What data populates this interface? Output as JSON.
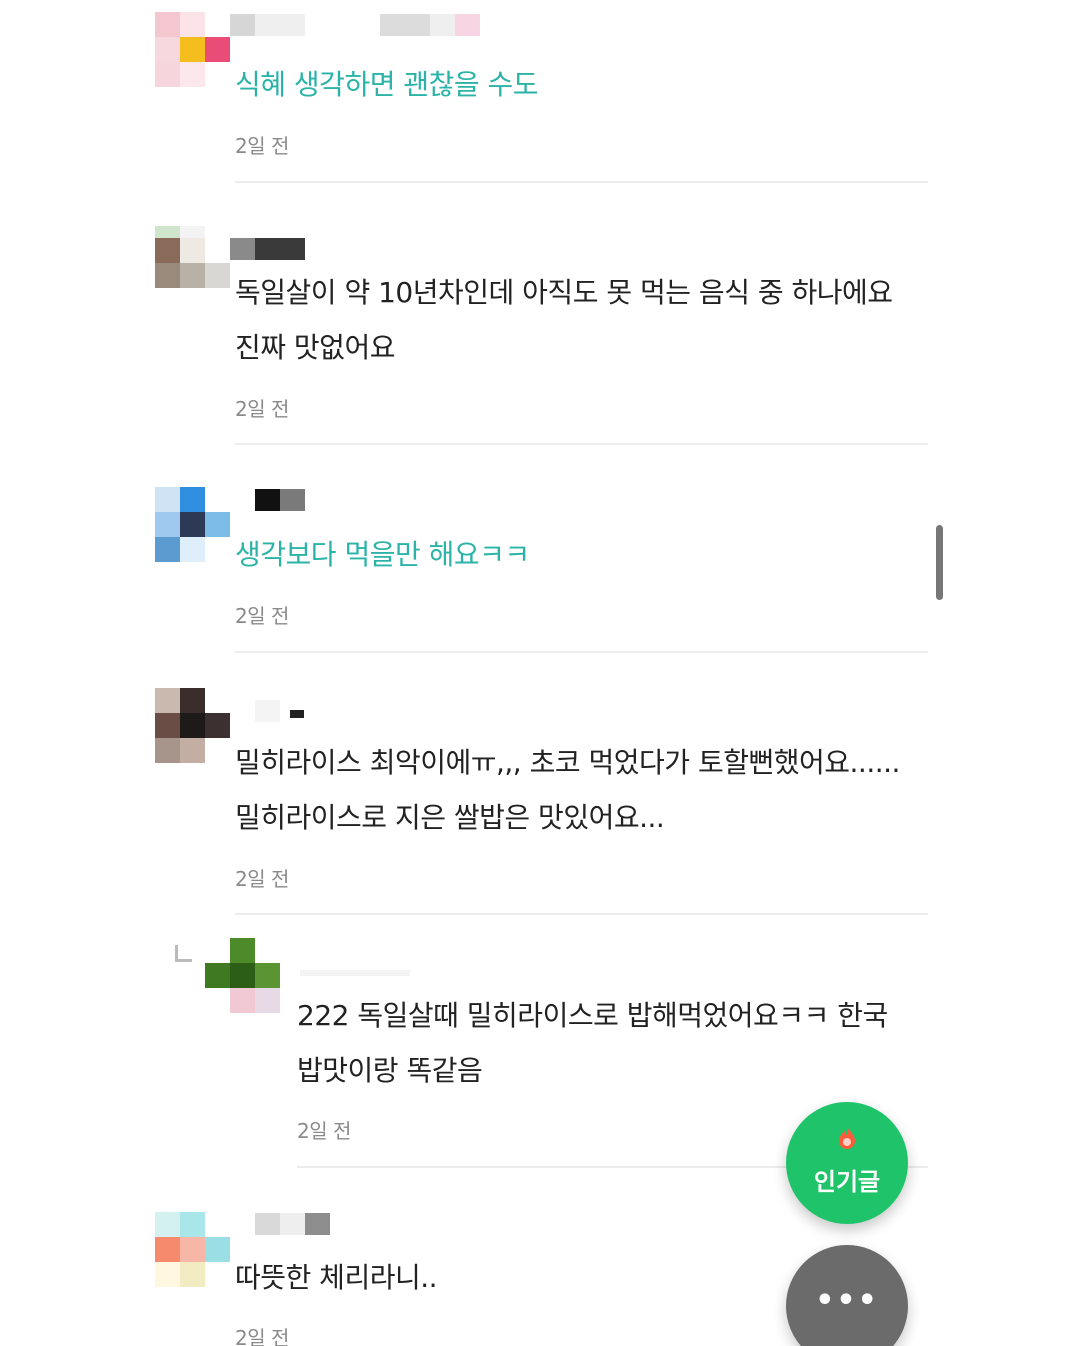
{
  "comments": [
    {
      "text": "식혜 생각하면 괜찮을 수도",
      "time": "2일 전"
    },
    {
      "text": "독일살이 약 10년차인데 아직도 못 먹는 음식 중 하나에요\n진짜 맛없어요",
      "time": "2일 전"
    },
    {
      "text": "생각보다 먹을만 해요ㅋㅋ",
      "time": "2일 전"
    },
    {
      "text": "밀히라이스 최악이에ㅠ,,, 초코 먹었다가 토할뻔했어요......\n밀히라이스로 지은 쌀밥은 맛있어요...",
      "time": "2일 전"
    },
    {
      "text": "222 독일살때 밀히라이스로 밥해먹었어요ㅋㅋ 한국\n밥맛이랑 똑같음",
      "time": "2일 전"
    },
    {
      "text": "따뜻한 체리라니..",
      "time": "2일 전"
    }
  ],
  "fab": {
    "popular_label": "인기글",
    "more_label": "•••"
  },
  "colors": {
    "accent_green": "#1fc46a",
    "highlight_teal": "#2bb3a8",
    "more_gray": "#6b6b6b"
  },
  "icons": [
    "fire-icon",
    "more-dots-icon",
    "reply-arrow-icon"
  ]
}
